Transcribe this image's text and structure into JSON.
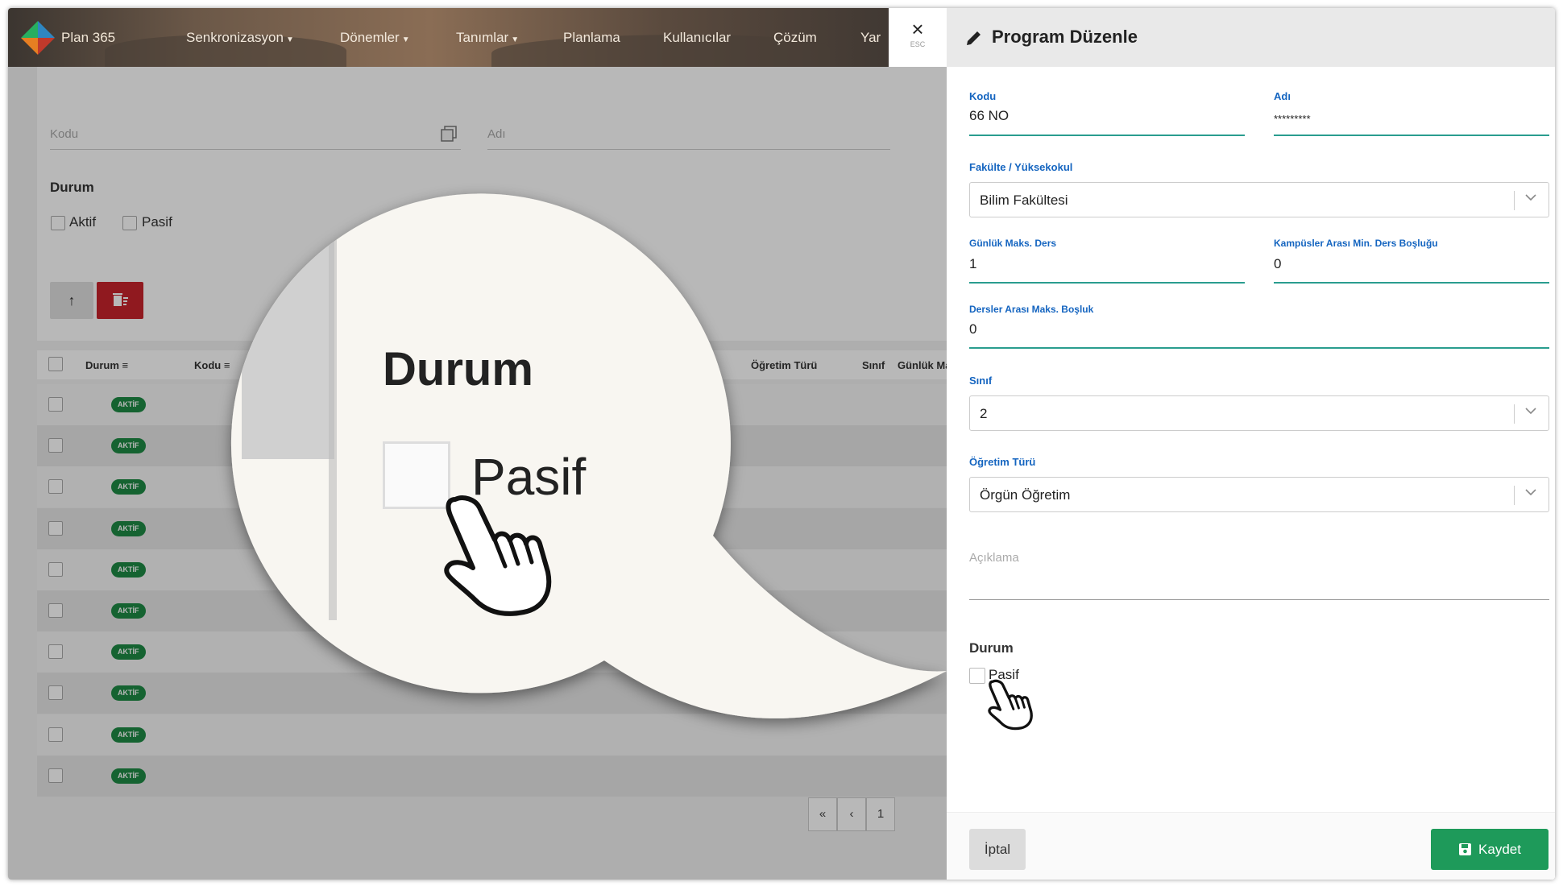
{
  "app": {
    "brand": "Plan 365",
    "nav": [
      "Senkronizasyon",
      "Dönemler",
      "Tanımlar",
      "Planlama",
      "Kullanıcılar",
      "Çözüm",
      "Yar"
    ],
    "close_label": "×",
    "esc_label": "ESC"
  },
  "filters": {
    "kodu_placeholder": "Kodu",
    "adi_placeholder": "Adı",
    "durum_label": "Durum",
    "aktif_label": "Aktif",
    "pasif_label": "Pasif"
  },
  "table": {
    "headers": [
      "Durum",
      "Kodu",
      "Öğretim Türü",
      "Sınıf",
      "Günlük Ma"
    ],
    "rows": [
      "AKTİF",
      "AKTİF",
      "AKTİF",
      "AKTİF",
      "AKTİF",
      "AKTİF",
      "AKTİF",
      "AKTİF",
      "AKTİF",
      "AKTİF"
    ],
    "pager": [
      "«",
      "‹",
      "1"
    ]
  },
  "callout": {
    "durum": "Durum",
    "pasif": "Pasif"
  },
  "panel": {
    "title": "Program Düzenle",
    "kodu_label": "Kodu",
    "kodu_value": "66 NO",
    "adi_label": "Adı",
    "adi_value": "*********",
    "fakulte_label": "Fakülte / Yüksekokul",
    "fakulte_value": "Bilim Fakültesi",
    "gunluk_label": "Günlük Maks. Ders",
    "gunluk_value": "1",
    "kampus_label": "Kampüsler Arası Min. Ders Boşluğu",
    "kampus_value": "0",
    "dersler_label": "Dersler Arası Maks. Boşluk",
    "dersler_value": "0",
    "sinif_label": "Sınıf",
    "sinif_value": "2",
    "ogretim_label": "Öğretim Türü",
    "ogretim_value": "Örgün Öğretim",
    "aciklama_placeholder": "Açıklama",
    "durum_label": "Durum",
    "pasif_label": "Pasif",
    "cancel_label": "İptal",
    "save_label": "Kaydet"
  },
  "colors": {
    "accent_teal": "#2a9d8f",
    "label_blue": "#1565c0",
    "save_green": "#1e9a5a",
    "delete_red": "#c8232c",
    "badge_green": "#1e8a45"
  }
}
